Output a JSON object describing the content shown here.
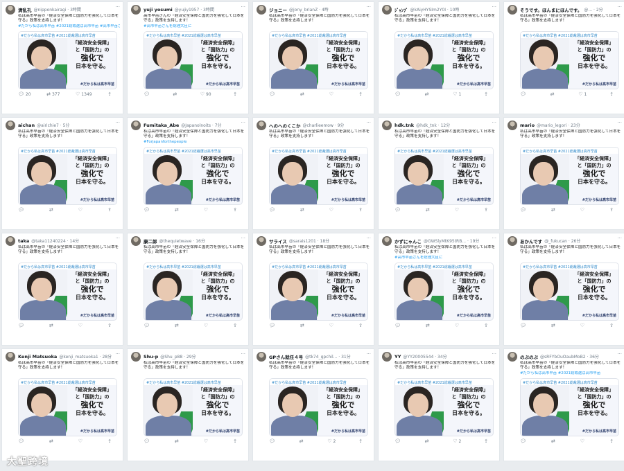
{
  "common": {
    "tweet_text": "私は高市早苗の「経済安全保障と国防力を強化して日本を守る」政策を支持します！",
    "card_banner": "#だから私は高市早苗 #2021総裁選は高市早苗",
    "slogan_line1": "「経済安全保障」",
    "slogan_line2": "と「国防力」の",
    "slogan_line3": "強化で",
    "slogan_line4": "日本を守る。",
    "card_footer": "#だから私は高市早苗",
    "more_icon": "more-dots",
    "reply_icon": "reply-bubble",
    "retweet_icon": "retweet-arrows",
    "like_icon": "heart",
    "share_icon": "share-upload"
  },
  "tweets": [
    {
      "name": "清乱孔",
      "handle": "@nipponkairagi · 3時間",
      "text": "私は高市早苗の「経済安全保障と国防力を強化して日本を守る」政策を支持します！",
      "tags": "#だから私は高市早苗 #2021総裁選は高市早苗 #高市早苗さんを総理大臣に",
      "replies": "20",
      "retweets": "377",
      "likes": "1349"
    },
    {
      "name": "yuji yosumi",
      "handle": "@yujiy1957 · 3時間",
      "text": "高市早苗さんの「経済安全保障と国防力を強化して日本を守る」政策を支持します！",
      "tags": "#高市早苗さんを総理大臣に",
      "replies": "",
      "retweets": "",
      "likes": "90"
    },
    {
      "name": "ジョニー",
      "handle": "@jony_brianZ · 4時",
      "text": "私は高市早苗の「経済安全保障と国防力を強化して日本を守る」政策を支持します！",
      "tags": "",
      "replies": "",
      "retweets": "",
      "likes": ""
    },
    {
      "name": "ｼﾞｬﾝﾌﾞ",
      "handle": "@kAiyHYSIm2Y0I · 10時",
      "text": "私は高市早苗の「経済安全保障と国防力を強化して日本を守る」政策を支持します！",
      "tags": "",
      "replies": "",
      "retweets": "",
      "likes": "1"
    },
    {
      "name": "そうです。ほんまにほんです。",
      "handle": "@... · 2分",
      "text": "私は高市早苗の「経済安全保障と国防力を強化して日本を守る」政策を支持します！",
      "tags": "",
      "replies": "",
      "retweets": "",
      "likes": "1"
    },
    {
      "name": "aichan",
      "handle": "@airichie7 · 5分",
      "text": "私は高市早苗の「経済安全保障と国防力を強化して日本を守る」政策を支持します！",
      "tags": "",
      "replies": "",
      "retweets": "",
      "likes": ""
    },
    {
      "name": "Fumitaka_Abe",
      "handle": "@Japanolnoits · 7分",
      "text": "私は高市早苗の「経済安全保障と国防力を強化して日本を守る」政策を支持します！",
      "tags": "#Forjapanforthepeople",
      "replies": "",
      "retweets": "",
      "likes": ""
    },
    {
      "name": "へのへのくこか",
      "handle": "@charlieemow · 9分",
      "text": "私は高市早苗の「経済安全保障と国防力を強化して日本を守る」政策を支持します！",
      "tags": "",
      "replies": "",
      "retweets": "",
      "likes": ""
    },
    {
      "name": "hdk.tnk",
      "handle": "@hdk_tnk · 12分",
      "text": "私は高市早苗の「経済安全保障と国防力を強化して日本を守る」政策を支持します！",
      "tags": "",
      "replies": "",
      "retweets": "",
      "likes": ""
    },
    {
      "name": "mario",
      "handle": "@mario_legori · 23分",
      "text": "私は高市早苗の「経済安全保障と国防力を強化して日本を守る」政策を支持します！",
      "tags": "",
      "replies": "",
      "retweets": "",
      "likes": ""
    },
    {
      "name": "taka",
      "handle": "@taka11240224 · 14分",
      "text": "私は高市早苗の「経済安全保障と国防力を強化して日本を守る」政策を支持します！",
      "tags": "",
      "replies": "",
      "retweets": "",
      "likes": ""
    },
    {
      "name": "康二郎",
      "handle": "@thequietwave · 16分",
      "text": "私は高市早苗の「経済安全保障と国防力を強化して日本を守る」政策を支持します！",
      "tags": "",
      "replies": "",
      "retweets": "",
      "likes": ""
    },
    {
      "name": "サライス",
      "handle": "@sarais1201 · 18分",
      "text": "私は高市早苗の「経済安全保障と国防力を強化して日本を守る」政策を支持します！",
      "tags": "",
      "replies": "",
      "retweets": "",
      "likes": ""
    },
    {
      "name": "かずにゃんこ",
      "handle": "@GWSlyMtK95tRB... · 19分",
      "text": "私は高市早苗の「経済安全保障と国防力を強化して日本を守る」政策を支持します！",
      "tags": "#高市早苗さんを総理大臣に",
      "replies": "",
      "retweets": "",
      "likes": ""
    },
    {
      "name": "あかんです",
      "handle": "@_fukucan · 26分",
      "text": "私は高市早苗の「経済安全保障と国防力を強化して日本を守る」政策を支持します！",
      "tags": "",
      "replies": "",
      "retweets": "",
      "likes": ""
    },
    {
      "name": "Kenji Matsuoka",
      "handle": "@kenji_matsuoka1 · 28分",
      "text": "私は高市早苗の「経済安全保障と国防力を強化して日本を守る」政策を支持します！",
      "tags": "",
      "replies": "",
      "retweets": "",
      "likes": ""
    },
    {
      "name": "Shu-p",
      "handle": "@Shu_p88 · 29分",
      "text": "私は高市早苗の「経済安全保障と国防力を強化して日本を守る」政策を支持します！",
      "tags": "",
      "replies": "",
      "retweets": "",
      "likes": ""
    },
    {
      "name": "GPさん就任４号",
      "handle": "@tk74_gpchil... · 31分",
      "text": "私は高市早苗の「経済安全保障と国防力を強化して日本を守る」政策を支持します！",
      "tags": "",
      "replies": "",
      "retweets": "",
      "likes": "2"
    },
    {
      "name": "YY",
      "handle": "@YY20005544 · 34分",
      "text": "私は高市早苗の「経済安全保障と国防力を強化して日本を守る」政策を支持します！",
      "tags": "",
      "replies": "",
      "retweets": "",
      "likes": "2"
    },
    {
      "name": "のぶのぶ",
      "handle": "@sRFYbOuOaubMoB2 · 36分",
      "text": "私は高市早苗の「経済安全保障と国防力を強化して日本を守る」政策を支持します！",
      "tags": "#だから私は高市早苗 #2021総裁選は高市早苗",
      "replies": "",
      "retweets": "",
      "likes": ""
    }
  ],
  "watermark": "大聖跨境"
}
